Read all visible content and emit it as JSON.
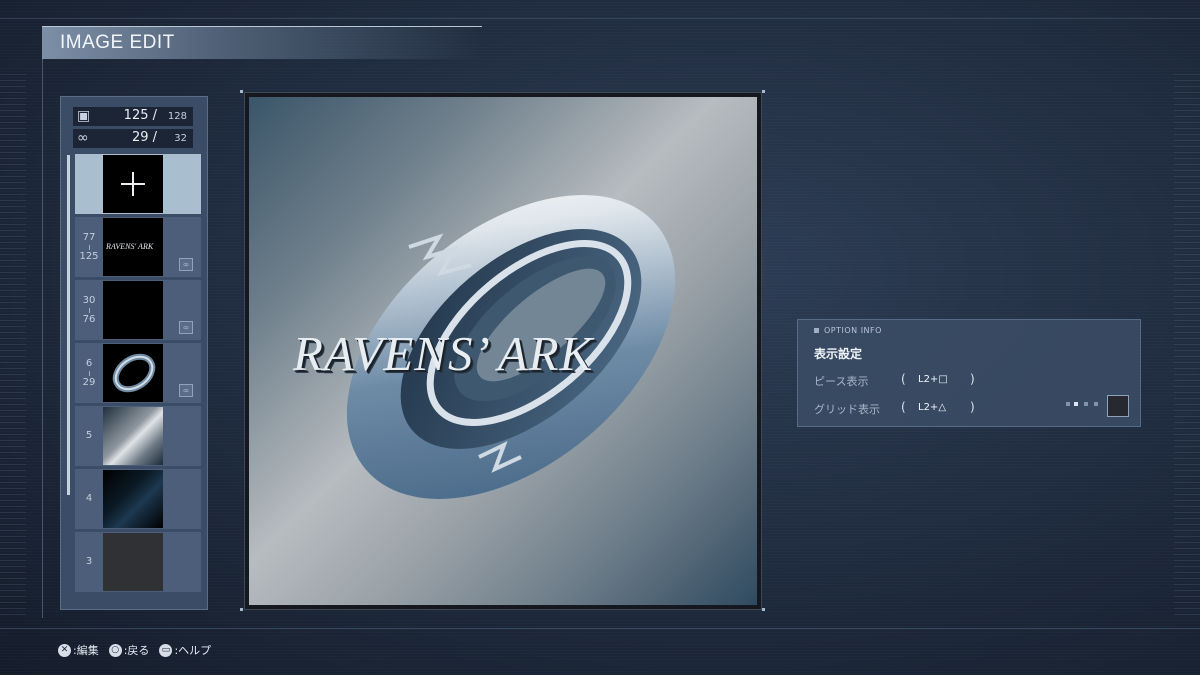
{
  "screen": {
    "title": "IMAGE EDIT"
  },
  "counters": {
    "pieces": {
      "icon": "layers-icon",
      "current": "125 /",
      "max": "128"
    },
    "links": {
      "icon": "link-icon",
      "current": "29 /",
      "max": "32"
    }
  },
  "layers": [
    {
      "type": "add",
      "selected": true
    },
    {
      "range_start": "77",
      "range_end": "125",
      "thumb_text": "RAVENS' ARK",
      "linked": true
    },
    {
      "range_start": "30",
      "range_end": "76",
      "thumb": "black",
      "linked": true
    },
    {
      "range_start": "6",
      "range_end": "29",
      "thumb": "ring",
      "linked": true
    },
    {
      "label": "5",
      "thumb": "gradient-silver"
    },
    {
      "label": "4",
      "thumb": "gradient-dark-blue"
    },
    {
      "label": "3",
      "thumb": "dark-grey"
    }
  ],
  "canvas": {
    "logo_text": "RAVENS’ ARK"
  },
  "option_info": {
    "header": "OPTION INFO",
    "subtitle": "表示設定",
    "rows": [
      {
        "label": "ピース表示",
        "open": "(",
        "combo": "L2+□",
        "close": ")"
      },
      {
        "label": "グリッド表示",
        "open": "(",
        "combo": "L2+△",
        "close": ")"
      }
    ],
    "grid_swatch_color": "#262a30"
  },
  "footer": {
    "items": [
      {
        "glyph": "✕",
        "label": ":編集"
      },
      {
        "glyph": "○",
        "label": ":戻る"
      },
      {
        "glyph": "▭",
        "label": ":ヘルプ"
      }
    ]
  }
}
